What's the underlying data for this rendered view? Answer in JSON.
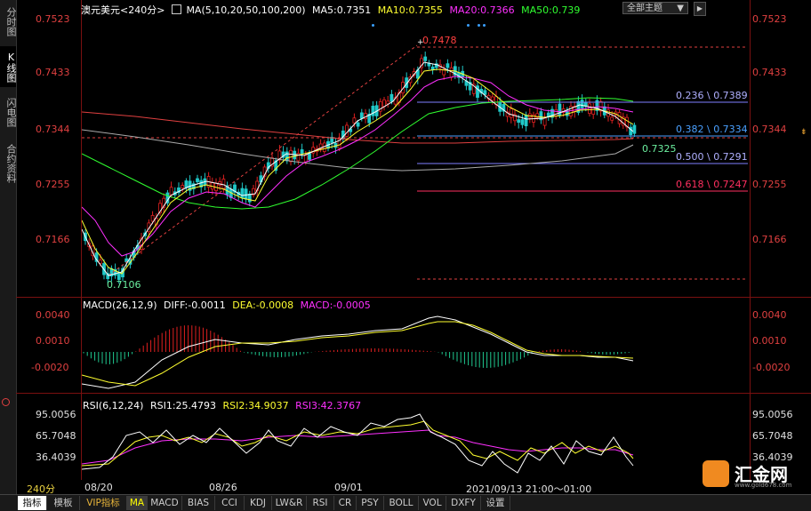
{
  "sidebar": {
    "tabs": [
      {
        "label": "分时图",
        "active": false
      },
      {
        "label": "K线图",
        "active": true
      },
      {
        "label": "闪电图",
        "active": false
      },
      {
        "label": "合约资料",
        "active": false
      }
    ]
  },
  "header": {
    "instrument": "澳元美元<240分>",
    "ma_indicator": "MA(5,10,20,50,100,200)",
    "ma5": "MA5:0.7351",
    "ma10": "MA10:0.7355",
    "ma20": "MA20:0.7366",
    "ma50": "MA50:0.739",
    "theme_button": "全部主题"
  },
  "price_axis": {
    "labels": [
      "0.7523",
      "0.7433",
      "0.7344",
      "0.7255",
      "0.7166"
    ],
    "colors": {
      "up": "#e02020",
      "down": "#20c8c8"
    }
  },
  "annotations": {
    "high": "0.7478",
    "low": "0.7106",
    "last": "0.7325"
  },
  "fibonacci": [
    {
      "label": "0.236 \\ 0.7389",
      "color": "#8080ff"
    },
    {
      "label": "0.382 \\ 0.7334",
      "color": "#4aa0ff"
    },
    {
      "label": "0.500 \\ 0.7291",
      "color": "#8080ff"
    },
    {
      "label": "0.618 \\ 0.7247",
      "color": "#ff3060"
    }
  ],
  "macd": {
    "title": "MACD(26,12,9)",
    "diff": "DIFF:-0.0011",
    "dea": "DEA:-0.0008",
    "macd": "MACD:-0.0005",
    "axis": [
      "0.0040",
      "0.0010",
      "-0.0020"
    ]
  },
  "rsi": {
    "title": "RSI(6,12,24)",
    "rsi1": "RSI1:25.4793",
    "rsi2": "RSI2:34.9037",
    "rsi3": "RSI3:42.3767",
    "axis": [
      "95.0056",
      "65.7048",
      "36.4039"
    ]
  },
  "dates": {
    "period": "240分",
    "d1": "08/20",
    "d2": "08/26",
    "d3": "09/01",
    "current": "2021/09/13 21:00～01:00"
  },
  "tabs": [
    {
      "label": "指标",
      "style": "active"
    },
    {
      "label": "模板",
      "style": ""
    },
    {
      "label": "VIP指标",
      "style": "vip"
    },
    {
      "label": "MA",
      "style": "ma"
    },
    {
      "label": "MACD",
      "style": ""
    },
    {
      "label": "BIAS",
      "style": ""
    },
    {
      "label": "CCI",
      "style": ""
    },
    {
      "label": "KDJ",
      "style": ""
    },
    {
      "label": "LW&R",
      "style": ""
    },
    {
      "label": "RSI",
      "style": ""
    },
    {
      "label": "CR",
      "style": ""
    },
    {
      "label": "PSY",
      "style": ""
    },
    {
      "label": "BOLL",
      "style": ""
    },
    {
      "label": "VOL",
      "style": ""
    },
    {
      "label": "DXFY",
      "style": ""
    },
    {
      "label": "设置",
      "style": ""
    }
  ],
  "logo": {
    "name": "汇金网",
    "url_text": "www.gold678.com"
  }
}
